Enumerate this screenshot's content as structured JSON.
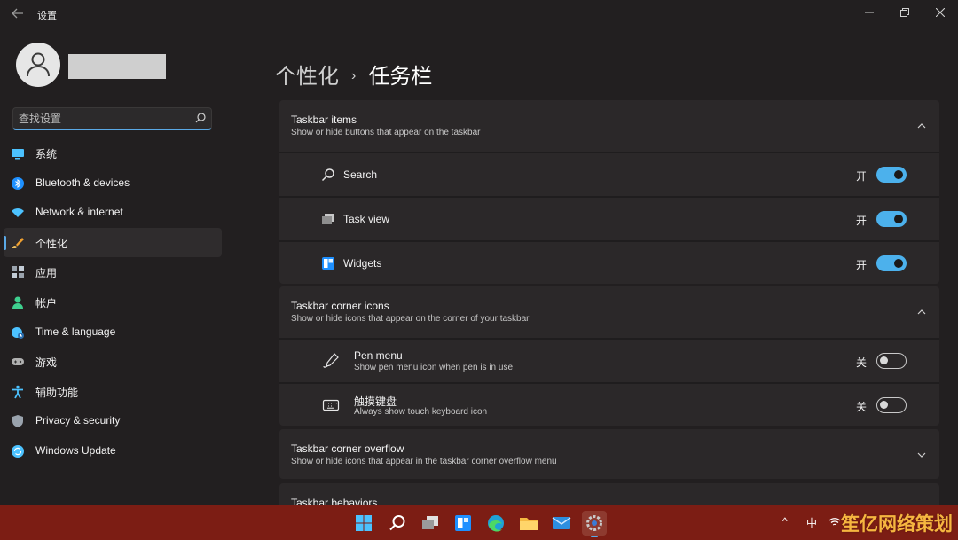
{
  "window": {
    "app_title": "设置",
    "controls": {
      "minimize": "—",
      "maximize": "▢",
      "close": "✕"
    }
  },
  "sidebar": {
    "search_placeholder": "查找设置",
    "items": [
      {
        "label": "系统",
        "icon": "monitor-icon",
        "color": "#4cc2ff"
      },
      {
        "label": "Bluetooth & devices",
        "icon": "bluetooth-icon",
        "color": "#1e90ff"
      },
      {
        "label": "Network & internet",
        "icon": "wifi-icon",
        "color": "#4cc2ff"
      },
      {
        "label": "个性化",
        "icon": "brush-icon",
        "color": "#f0a030",
        "active": true
      },
      {
        "label": "应用",
        "icon": "apps-icon",
        "color": "#9aa3ad"
      },
      {
        "label": "帐户",
        "icon": "person-icon",
        "color": "#3ecf8e"
      },
      {
        "label": "Time & language",
        "icon": "globe-clock-icon",
        "color": "#4cc2ff"
      },
      {
        "label": "游戏",
        "icon": "gamepad-icon",
        "color": "#b0b0b0"
      },
      {
        "label": "辅助功能",
        "icon": "accessibility-icon",
        "color": "#4cc2ff"
      },
      {
        "label": "Privacy & security",
        "icon": "shield-icon",
        "color": "#9aa3ad"
      },
      {
        "label": "Windows Update",
        "icon": "update-icon",
        "color": "#4cc2ff"
      }
    ]
  },
  "main": {
    "breadcrumb_parent": "个性化",
    "breadcrumb_sep": "›",
    "breadcrumb_current": "任务栏",
    "sections": [
      {
        "title": "Taskbar items",
        "subtitle": "Show or hide buttons that appear on the taskbar",
        "expanded": true,
        "rows": [
          {
            "label": "Search",
            "icon": "search-icon",
            "state": "开",
            "on": true
          },
          {
            "label": "Task view",
            "icon": "task-view-icon",
            "state": "开",
            "on": true
          },
          {
            "label": "Widgets",
            "icon": "widgets-icon",
            "state": "开",
            "on": true
          }
        ]
      },
      {
        "title": "Taskbar corner icons",
        "subtitle": "Show or hide icons that appear on the corner of your taskbar",
        "expanded": true,
        "rows": [
          {
            "label": "Pen menu",
            "sub": "Show pen menu icon when pen is in use",
            "icon": "pen-icon",
            "state": "关",
            "on": false
          },
          {
            "label": "触摸键盘",
            "sub": "Always show touch keyboard icon",
            "icon": "keyboard-icon",
            "state": "关",
            "on": false
          }
        ]
      },
      {
        "title": "Taskbar corner overflow",
        "subtitle": "Show or hide icons that appear in the taskbar corner overflow menu",
        "expanded": false
      },
      {
        "title": "Taskbar behaviors"
      }
    ]
  },
  "taskbar": {
    "apps": [
      "start-icon",
      "search-icon",
      "task-view-icon",
      "widgets-icon",
      "edge-icon",
      "file-explorer-icon",
      "mail-icon",
      "settings-icon"
    ],
    "tray_chevron": "^",
    "ime": "中",
    "background": "#7c1d14"
  },
  "watermark": "笙亿网络策划",
  "colors": {
    "accent": "#4cb1ec",
    "window_bg": "#221f20",
    "card_bg": "#2b2829"
  }
}
